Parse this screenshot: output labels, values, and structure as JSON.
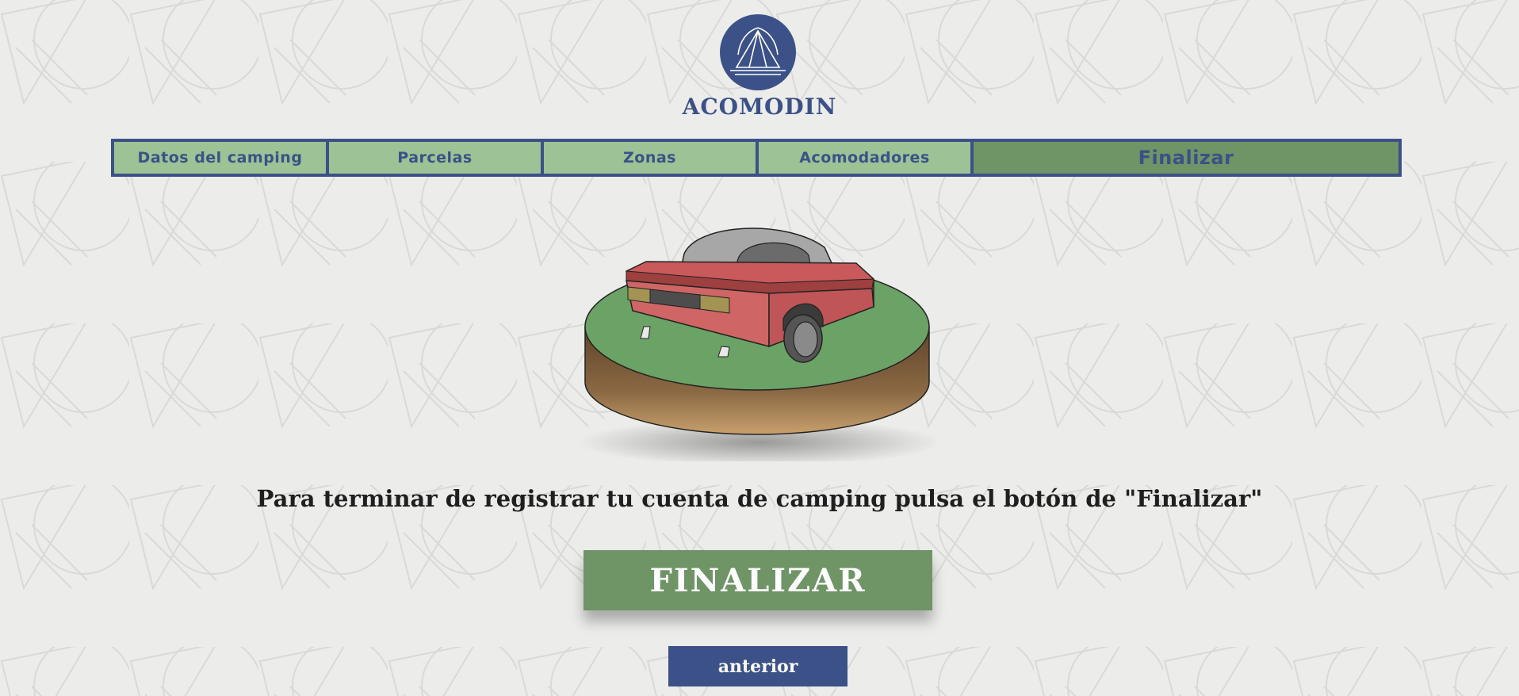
{
  "brand": {
    "name": "ACOMODIN",
    "logo_icon": "tent-mountain-logo-icon"
  },
  "nav": {
    "tabs": [
      {
        "label": "Datos del camping",
        "active": false
      },
      {
        "label": "Parcelas",
        "active": false
      },
      {
        "label": "Zonas",
        "active": false
      },
      {
        "label": "Acomodadores",
        "active": false
      },
      {
        "label": "Finalizar",
        "active": true
      }
    ]
  },
  "illustration": {
    "icon": "camper-trailer-on-grass-icon"
  },
  "main": {
    "message": "Para terminar de registrar tu cuenta de camping pulsa el botón de \"Finalizar\"",
    "finalize_label": "FINALIZAR",
    "previous_label": "anterior"
  },
  "colors": {
    "primary_blue": "#3b5187",
    "tab_green": "#9cc296",
    "active_green": "#6f9466",
    "background": "#ececea"
  }
}
